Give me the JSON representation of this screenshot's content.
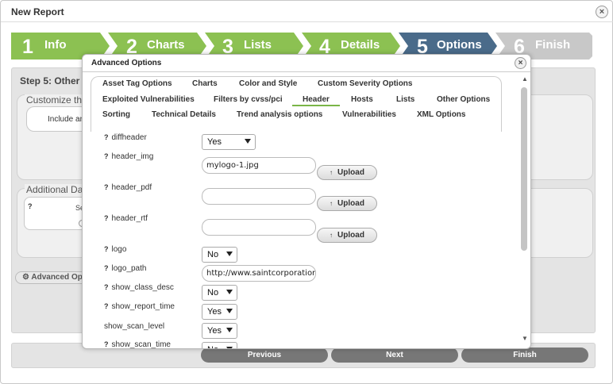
{
  "window": {
    "title": "New Report",
    "close_glyph": "×"
  },
  "wizard": {
    "steps": [
      {
        "num": "1",
        "label": "Info",
        "state": "done",
        "color": "#8cc152"
      },
      {
        "num": "2",
        "label": "Charts",
        "state": "done",
        "color": "#8cc152"
      },
      {
        "num": "3",
        "label": "Lists",
        "state": "done",
        "color": "#8cc152"
      },
      {
        "num": "4",
        "label": "Details",
        "state": "done",
        "color": "#8cc152"
      },
      {
        "num": "5",
        "label": "Options",
        "state": "current",
        "color": "#4a6b8a"
      },
      {
        "num": "6",
        "label": "Finish",
        "state": "future",
        "color": "#c8c8c8"
      }
    ]
  },
  "background": {
    "step_label": "Step 5: Other",
    "customize_legend": "Customize the",
    "include_text": "Include an",
    "additional_legend": "Additional Dat",
    "question_mark": "?",
    "se_text": "Se",
    "advanced_button": "Advanced Op"
  },
  "nav": {
    "previous": "Previous",
    "next": "Next",
    "finish": "Finish"
  },
  "modal": {
    "title": "Advanced Options",
    "close_glyph": "×",
    "tabs": [
      "Asset Tag Options",
      "Charts",
      "Color and Style",
      "Custom Severity Options",
      "Exploited Vulnerabilities",
      "Filters by cvss/pci",
      "Header",
      "Hosts",
      "Lists",
      "Other Options",
      "Sorting",
      "Technical Details",
      "Trend analysis options",
      "Vulnerabilities",
      "XML Options"
    ],
    "active_tab": "Header",
    "options": {
      "diffheader": {
        "label": "diffheader",
        "value": "Yes"
      },
      "header_img": {
        "label": "header_img",
        "value": "mylogo-1.jpg",
        "button": "Upload"
      },
      "header_pdf": {
        "label": "header_pdf",
        "value": "",
        "button": "Upload"
      },
      "header_rtf": {
        "label": "header_rtf",
        "value": "",
        "button": "Upload"
      },
      "logo": {
        "label": "logo",
        "value": "No"
      },
      "logo_path": {
        "label": "logo_path",
        "value": "http://www.saintcorporatior"
      },
      "show_class_desc": {
        "label": "show_class_desc",
        "value": "No"
      },
      "show_report_time": {
        "label": "show_report_time",
        "value": "Yes"
      },
      "show_scan_level": {
        "label": "show_scan_level",
        "value": "Yes"
      },
      "show_scan_time": {
        "label": "show_scan_time",
        "value": "No"
      }
    },
    "help_glyph": "?",
    "upload_icon": "↑",
    "scroll_up_glyph": "▲",
    "scroll_down_glyph": "▼"
  }
}
